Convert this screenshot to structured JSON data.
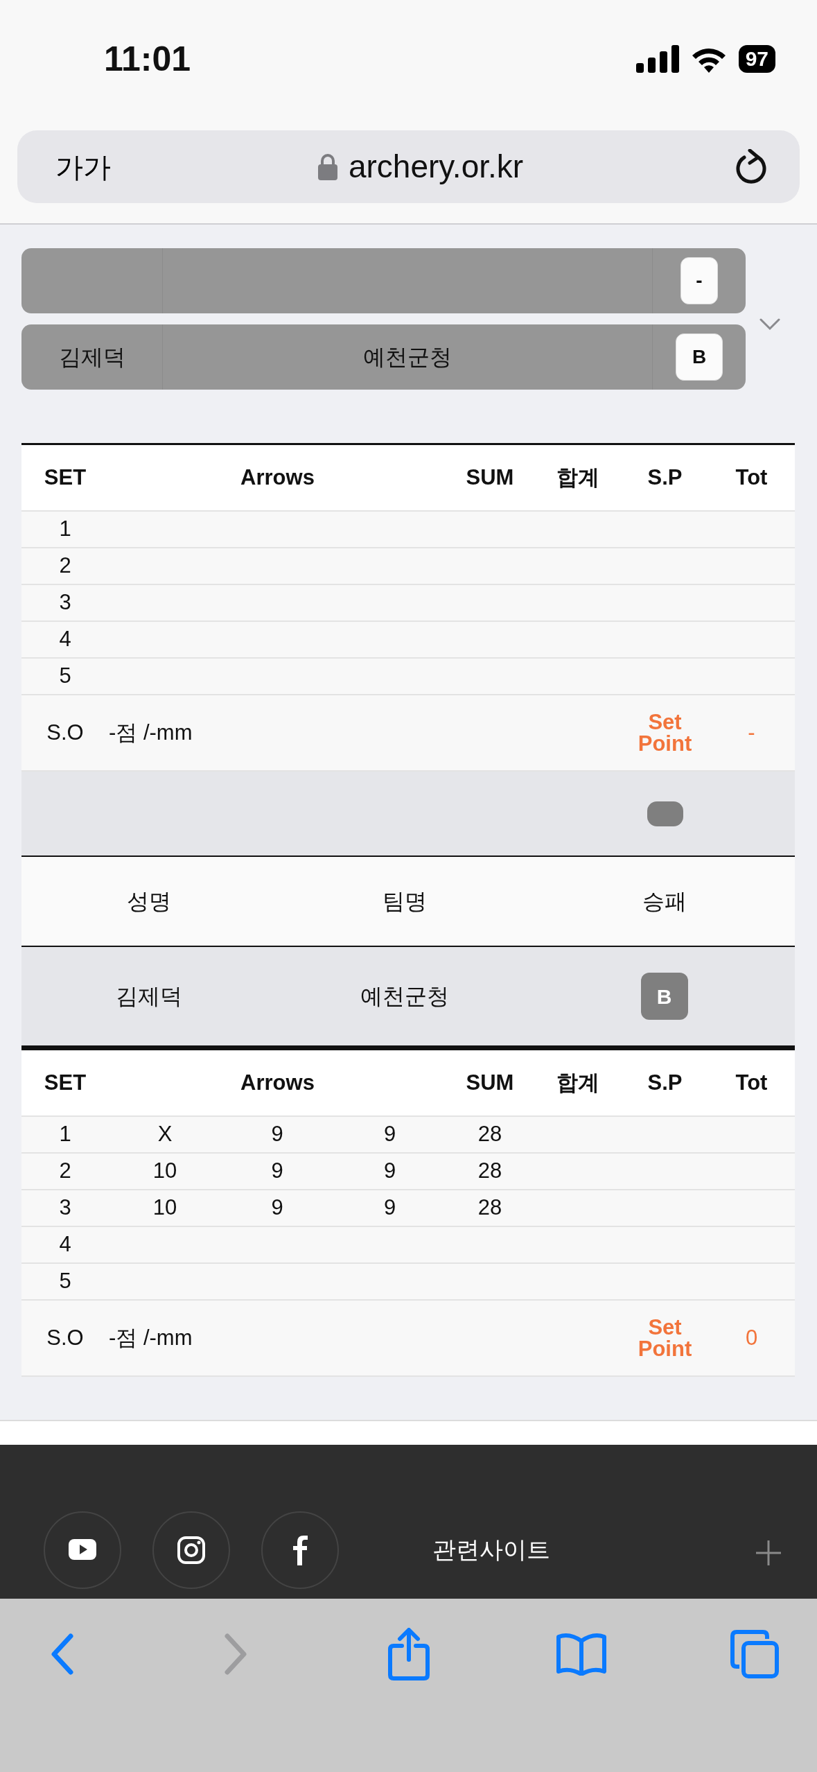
{
  "status_bar": {
    "time": "11:01",
    "battery": "97"
  },
  "address_bar": {
    "text_size_button": "가가",
    "url": "archery.or.kr"
  },
  "match_cards": [
    {
      "result": "-"
    },
    {
      "name": "김제덕",
      "team": "예천군청",
      "result": "B"
    }
  ],
  "score_tables": [
    {
      "columns": [
        "SET",
        "Arrows",
        "SUM",
        "합계",
        "S.P",
        "Tot"
      ],
      "rows": [
        {
          "set": "1"
        },
        {
          "set": "2"
        },
        {
          "set": "3"
        },
        {
          "set": "4"
        },
        {
          "set": "5"
        }
      ],
      "shoot_off": {
        "label": "S.O",
        "value": "-점 /-mm",
        "set_point": "Set Point",
        "total": "-"
      },
      "status_pill": true,
      "players": {
        "columns": [
          "성명",
          "팀명",
          "승패"
        ],
        "rows": [
          {
            "name": "김제덕",
            "team": "예천군청",
            "result": "B"
          }
        ]
      }
    },
    {
      "columns": [
        "SET",
        "Arrows",
        "SUM",
        "합계",
        "S.P",
        "Tot"
      ],
      "rows": [
        {
          "set": "1",
          "arrows": [
            "X",
            "9",
            "9"
          ],
          "sum": "28"
        },
        {
          "set": "2",
          "arrows": [
            "10",
            "9",
            "9"
          ],
          "sum": "28"
        },
        {
          "set": "3",
          "arrows": [
            "10",
            "9",
            "9"
          ],
          "sum": "28"
        },
        {
          "set": "4"
        },
        {
          "set": "5"
        }
      ],
      "shoot_off": {
        "label": "S.O",
        "value": "-점 /-mm",
        "set_point": "Set Point",
        "total": "0"
      }
    }
  ],
  "footer": {
    "heading": "관련사이트"
  },
  "toolbar": {
    "buttons": [
      {
        "kind": "back",
        "disabled": false
      },
      {
        "kind": "forward",
        "disabled": true
      },
      {
        "kind": "share"
      },
      {
        "kind": "bookmarks"
      },
      {
        "kind": "tabs"
      }
    ]
  }
}
